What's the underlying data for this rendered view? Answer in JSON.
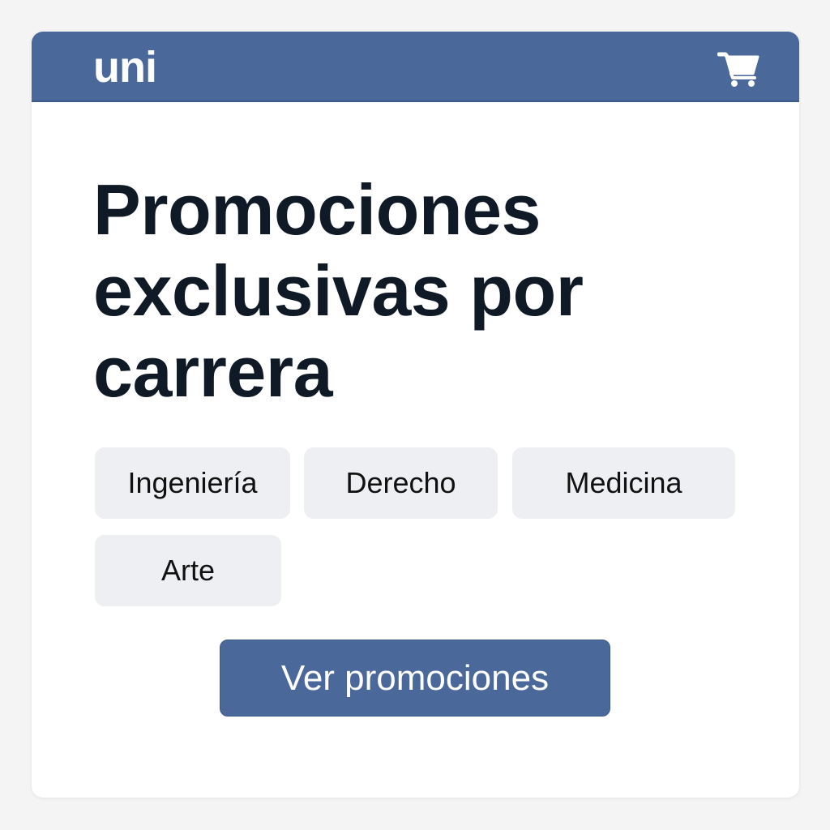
{
  "header": {
    "logo": "uni",
    "cart_icon": "cart-icon",
    "background_color": "#4a6899"
  },
  "main": {
    "title": "Promociones exclusivas por carrera",
    "careers": [
      {
        "label": "Ingeniería"
      },
      {
        "label": "Derecho"
      },
      {
        "label": "Medicina"
      },
      {
        "label": "Arte"
      }
    ],
    "cta_label": "Ver promociones"
  },
  "colors": {
    "accent": "#4a6899",
    "chip_background": "#eeeff3",
    "title_text": "#0f1a26",
    "page_background": "#f4f4f5"
  }
}
